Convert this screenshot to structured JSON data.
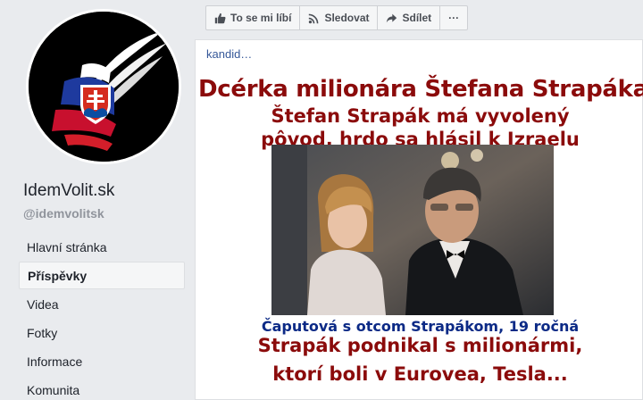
{
  "page": {
    "name": "IdemVolit.sk",
    "handle": "@idemvolitsk"
  },
  "nav": {
    "items": [
      {
        "label": "Hlavní stránka",
        "active": false
      },
      {
        "label": "Příspěvky",
        "active": true
      },
      {
        "label": "Videa",
        "active": false
      },
      {
        "label": "Fotky",
        "active": false
      },
      {
        "label": "Informace",
        "active": false
      },
      {
        "label": "Komunita",
        "active": false
      }
    ]
  },
  "actions": {
    "like": "To se mi líbí",
    "follow": "Sledovat",
    "share": "Sdílet",
    "more": "···"
  },
  "post": {
    "text": "kandid…",
    "image": {
      "headline": "Dcérka milionára Štefana Strapáka",
      "sub1": "Štefan Strapák má vyvolený",
      "sub2": "pôvod, hrdo sa hlásil k Izraelu",
      "caption": "Čaputová s otcom Strapákom, 19 ročná",
      "bottom1": "Strapák podnikal s milionármi,",
      "bottom2": "ktorí boli v Eurovea, Tesla..."
    }
  },
  "colors": {
    "link": "#365899",
    "headline": "#8b0b0b",
    "caption": "#0c2a86"
  }
}
